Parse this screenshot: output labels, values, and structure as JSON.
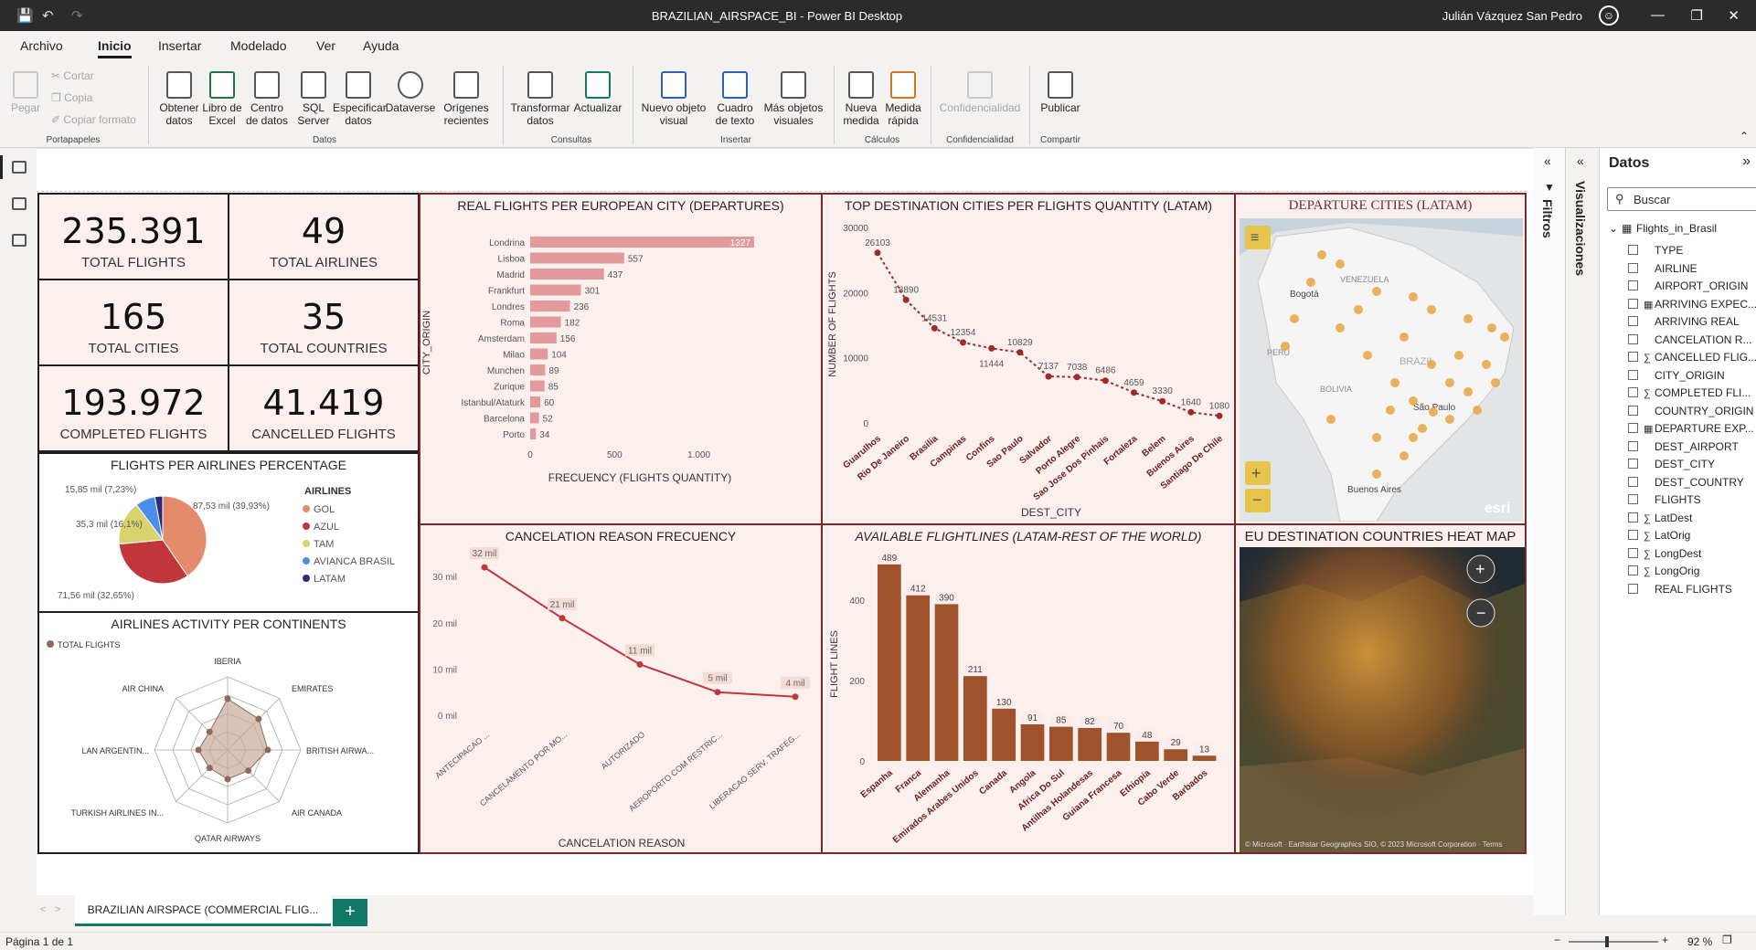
{
  "window": {
    "title": "BRAZILIAN_AIRSPACE_BI - Power BI Desktop",
    "user": "Julián Vázquez San Pedro"
  },
  "menu": {
    "items": [
      "Archivo",
      "Inicio",
      "Insertar",
      "Modelado",
      "Ver",
      "Ayuda"
    ],
    "active": "Inicio"
  },
  "ribbon": {
    "portapapeles": {
      "pegar": "Pegar",
      "cortar": "Cortar",
      "copia": "Copia",
      "copiar_formato": "Copiar formato",
      "group": "Portapapeles"
    },
    "datos": {
      "obtener": "Obtener datos",
      "excel": "Libro de Excel",
      "centro": "Centro de datos",
      "sql": "SQL Server",
      "especificar": "Especificar datos",
      "dataverse": "Dataverse",
      "origenes": "Orígenes recientes",
      "group": "Datos"
    },
    "consultas": {
      "transformar": "Transformar datos",
      "actualizar": "Actualizar",
      "group": "Consultas"
    },
    "insertar": {
      "nuevo": "Nuevo objeto visual",
      "cuadro": "Cuadro de texto",
      "mas": "Más objetos visuales",
      "group": "Insertar"
    },
    "calculos": {
      "medida": "Nueva medida",
      "rapida": "Medida rápida",
      "group": "Cálculos"
    },
    "conf": {
      "label": "Confidencialidad",
      "group": "Confidencialidad"
    },
    "compartir": {
      "publicar": "Publicar",
      "group": "Compartir"
    }
  },
  "kpis": [
    {
      "value": "235.391",
      "label": "TOTAL FLIGHTS"
    },
    {
      "value": "49",
      "label": "TOTAL AIRLINES"
    },
    {
      "value": "165",
      "label": "TOTAL CITIES"
    },
    {
      "value": "35",
      "label": "TOTAL COUNTRIES"
    },
    {
      "value": "193.972",
      "label": "COMPLETED FLIGHTS"
    },
    {
      "value": "41.419",
      "label": "CANCELLED FLIGHTS"
    }
  ],
  "titles": {
    "pie": "FLIGHTS PER AIRLINES PERCENTAGE",
    "radar": "AIRLINES ACTIVITY PER CONTINENTS",
    "eu_bar": "REAL FLIGHTS PER EUROPEAN CITY (DEPARTURES)",
    "cancel": "CANCELATION REASON FRECUENCY",
    "latam_line": "TOP DESTINATION CITIES PER FLIGHTS QUANTITY (LATAM)",
    "lines_bar": "AVAILABLE FLIGHTLINES (LATAM-REST OF THE WORLD)",
    "map1": "DEPARTURE CITIES (LATAM)",
    "map2": "EU DESTINATION COUNTRIES HEAT MAP"
  },
  "chart_data": [
    {
      "type": "pie",
      "title": "FLIGHTS PER AIRLINES PERCENTAGE",
      "legend_title": "AIRLINES",
      "categories": [
        "GOL",
        "AZUL",
        "TAM",
        "AVIANCA BRASIL",
        "LATAM"
      ],
      "values": [
        87.53,
        71.56,
        35.3,
        15.85,
        6.3
      ],
      "labels": [
        "87,53 mil (39,93%)",
        "71,56 mil (32,65%)",
        "35,3 mil (16,1%)",
        "15,85 mil (7,23%)",
        ""
      ],
      "colors": [
        "#e38b6a",
        "#c0363a",
        "#d9d26d",
        "#4a8fe7",
        "#2c2c7c"
      ]
    },
    {
      "type": "bar",
      "orientation": "horizontal",
      "title": "REAL FLIGHTS PER EUROPEAN CITY (DEPARTURES)",
      "xlabel": "FRECUENCY (FLIGHTS QUANTITY)",
      "ylabel": "CITY_ORIGIN",
      "categories": [
        "Londrina",
        "Lisboa",
        "Madrid",
        "Frankfurt",
        "Londres",
        "Roma",
        "Amsterdam",
        "Milao",
        "Munchen",
        "Zurique",
        "Istanbul/Ataturk",
        "Barcelona",
        "Porto"
      ],
      "values": [
        1327,
        557,
        437,
        301,
        236,
        182,
        156,
        104,
        89,
        85,
        60,
        52,
        34
      ],
      "xticks": [
        "0",
        "500",
        "1.000"
      ],
      "xlim": [
        0,
        1300
      ]
    },
    {
      "type": "line",
      "title": "TOP DESTINATION CITIES PER FLIGHTS QUANTITY (LATAM)",
      "xlabel": "DEST_CITY",
      "ylabel": "NUMBER OF FLIGHTS",
      "categories": [
        "Guarulhos",
        "Rio De Janeiro",
        "Brasilia",
        "Campinas",
        "Confins",
        "Sao Paulo",
        "Salvador",
        "Porto Alegre",
        "Sao Jose Dos Pinhais",
        "Fortaleza",
        "Belem",
        "Buenos Aires",
        "Santiago De Chile"
      ],
      "values": [
        26103,
        18890,
        14531,
        12354,
        11444,
        10829,
        7137,
        7038,
        6486,
        4659,
        3330,
        1640,
        1080
      ],
      "yticks": [
        "0",
        "10000",
        "20000",
        "30000"
      ],
      "ylim": [
        0,
        30000
      ]
    },
    {
      "type": "line",
      "title": "CANCELATION REASON FRECUENCY",
      "xlabel": "CANCELATION REASON",
      "categories": [
        "ANTECIPACAO ...",
        "CANCELAMENTO POR MO...",
        "AUTORIZADO",
        "AEROPORTO COM RESTRIC...",
        "LIBERACAO SERV. TRAFEG..."
      ],
      "values": [
        32,
        21,
        11,
        5,
        4
      ],
      "labels": [
        "32 mil",
        "21 mil",
        "11 mil",
        "5 mil",
        "4 mil"
      ],
      "yticks": [
        "0 mil",
        "10 mil",
        "20 mil",
        "30 mil"
      ],
      "ylim": [
        0,
        34
      ]
    },
    {
      "type": "bar",
      "title": "AVAILABLE FLIGHTLINES (LATAM-REST OF THE WORLD)",
      "ylabel": "FLIGHT LINES",
      "categories": [
        "Espanha",
        "Franca",
        "Alemanha",
        "Emirados Arabes Unidos",
        "Canada",
        "Angola",
        "Africa Do Sul",
        "Antilhas Holandesas",
        "Guiana Francesa",
        "Ethiopia",
        "Cabo Verde",
        "Barbados"
      ],
      "values": [
        489,
        412,
        390,
        211,
        130,
        91,
        85,
        82,
        70,
        48,
        29,
        13
      ],
      "yticks": [
        "0",
        "200",
        "400"
      ],
      "ylim": [
        0,
        500
      ]
    },
    {
      "type": "radar",
      "title": "AIRLINES ACTIVITY PER CONTINENTS",
      "legend": "TOTAL FLIGHTS",
      "axes": [
        "IBERIA",
        "EMIRATES",
        "BRITISH AIRWA...",
        "AIR CANADA",
        "QATAR AIRWAYS",
        "TURKISH AIRLINES IN...",
        "LAN ARGENTIN...",
        "AIR CHINA"
      ],
      "values": [
        0.7,
        0.6,
        0.55,
        0.4,
        0.4,
        0.35,
        0.4,
        0.35
      ]
    }
  ],
  "maps": {
    "map1_labels": [
      "VENEZUELA",
      "Bogotá",
      "PERÚ",
      "BRAZIL",
      "BOLIVIA",
      "São Paulo",
      "Buenos Aires"
    ],
    "esri": "esri",
    "attribution": "© Microsoft · Earthstar Geographics SIO, © 2023 Microsoft Corporation · Terms"
  },
  "panes": {
    "filters": "Filtros",
    "viz": "Visualizaciones",
    "data": "Datos",
    "search_placeholder": "Buscar",
    "table": "Flights_in_Brasil"
  },
  "fields": [
    {
      "name": "TYPE",
      "kind": ""
    },
    {
      "name": "AIRLINE",
      "kind": ""
    },
    {
      "name": "AIRPORT_ORIGIN",
      "kind": ""
    },
    {
      "name": "ARRIVING EXPEC...",
      "kind": "table"
    },
    {
      "name": "ARRIVING REAL",
      "kind": ""
    },
    {
      "name": "CANCELATION R...",
      "kind": ""
    },
    {
      "name": "CANCELLED FLIG...",
      "kind": "sum"
    },
    {
      "name": "CITY_ORIGIN",
      "kind": ""
    },
    {
      "name": "COMPLETED FLI...",
      "kind": "sum"
    },
    {
      "name": "COUNTRY_ORIGIN",
      "kind": ""
    },
    {
      "name": "DEPARTURE EXP...",
      "kind": "table"
    },
    {
      "name": "DEST_AIRPORT",
      "kind": ""
    },
    {
      "name": "DEST_CITY",
      "kind": ""
    },
    {
      "name": "DEST_COUNTRY",
      "kind": ""
    },
    {
      "name": "FLIGHTS",
      "kind": ""
    },
    {
      "name": "LatDest",
      "kind": "sum"
    },
    {
      "name": "LatOrig",
      "kind": "sum"
    },
    {
      "name": "LongDest",
      "kind": "sum"
    },
    {
      "name": "LongOrig",
      "kind": "sum"
    },
    {
      "name": "REAL FLIGHTS",
      "kind": ""
    }
  ],
  "tab": {
    "label": "BRAZILIAN AIRSPACE (COMMERCIAL FLIG...",
    "add": "+"
  },
  "status": {
    "page": "Página 1 de 1",
    "zoom": "92 %"
  }
}
